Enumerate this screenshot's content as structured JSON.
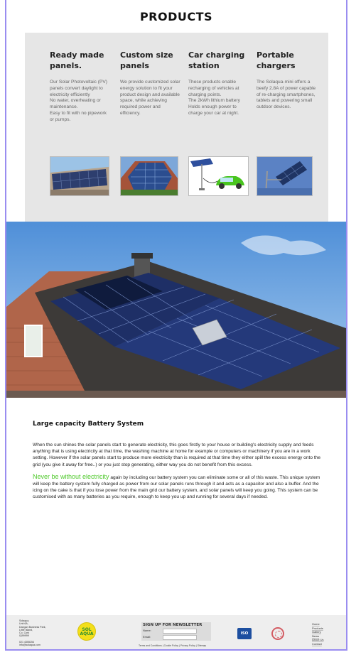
{
  "page_title": "PRODUCTS",
  "products": [
    {
      "title": "Ready made panels.",
      "description": "Our Solar Photovoltaic (PV) panels convert daylight to electricity efficiently\nNo water, overheating or maintenance.\nEasy to fit with no pipework or pumps."
    },
    {
      "title": "Custom size panels",
      "description": "We provide customized solar energy solution to fit your product design and available space, while achieving required power and efficiency."
    },
    {
      "title": "Car charging station",
      "description": "These products enable recharging of vehicles at charging points.\nThe 2kWh lithium battery Holds enough power to charge your car at night."
    },
    {
      "title": "Portable chargers",
      "description": "The Solaqua-mini offers a beefy 2.8A of power capable of re-charging smartphones, tablets and powering small outdoor devices."
    }
  ],
  "article": {
    "heading": "Large capacity Battery System",
    "paragraph1": "When the sun shines the solar panels start to generate electricity, this goes firstly to your house or building's electricity supply and feeds anything that is using electricity at that time, the washing machine at home for example or computers or machinery if you are in a work setting. However if the solar panels start to produce more electricity than is required at that time they either spill the excess energy onto the grid (you give it away for free..) or you just stop generating, either way you do not benefit from this excess.",
    "highlight": "Never be without electricity",
    "paragraph2": " again by including our battery system you can eliminate some or all of this waste. This unique system will keep the battery system fully charged as power from our solar panels runs through it and acts as a capacitor and also a buffer. And the icing on the cake is that if you lose power from the main grid our battery system, and solar panels will keep you going. This system can be customised with as many batteries as you require, enough to keep you up and running for several days if needed."
  },
  "footer": {
    "address": "Solaqua,\nUnit 6A,\nDangan Business Park,\nLittle Island,\nCo. Cork\nIQ99999\n\n021 4355254\ninfo@solaqua.com",
    "logo_text_top": "SOL",
    "logo_text_bottom": "AQUA",
    "newsletter_title": "SIGN UP FOR NEWSLETTER",
    "name_label": "Name:",
    "email_label": "Email:",
    "legal_links": [
      "Terms and Conditions",
      "Cookie Policy",
      "Privacy Policy",
      "Sitemap"
    ],
    "iso_label": "ISO",
    "nav": [
      "Home",
      "Products",
      "Gallery",
      "News",
      "About Us",
      "Contact"
    ]
  },
  "colors": {
    "frame_border": "#9a8df0",
    "panel_bg": "#e6e6e6",
    "highlight_green": "#4ec92a",
    "logo_yellow": "#f3df1a"
  }
}
